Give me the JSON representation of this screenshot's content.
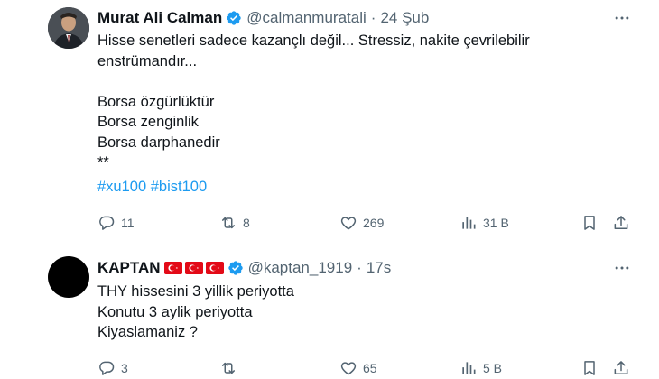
{
  "tweets": [
    {
      "name": "Murat Ali Calman",
      "handle": "@calmanmuratali",
      "separator": "·",
      "time": "24 Şub",
      "lines": [
        "Hisse senetleri sadece kazançlı değil... Stressiz, nakite çevrilebilir",
        "enstrümandır...",
        "",
        "Borsa özgürlüktür",
        "Borsa zenginlik",
        "Borsa darphanedir",
        "**"
      ],
      "hashtags": [
        "#xu100",
        "#bist100"
      ],
      "replies": "11",
      "retweets": "8",
      "likes": "269",
      "views": "31 B"
    },
    {
      "name": "KAPTAN",
      "flags": [
        "turkey-flag",
        "turkey-flag",
        "turkey-flag"
      ],
      "handle": "@kaptan_1919",
      "separator": "·",
      "time": "17s",
      "lines": [
        "THY hissesini 3 yillik periyotta",
        "Konutu 3 aylik periyotta",
        "Kiyaslamaniz  ?"
      ],
      "replies": "3",
      "retweets": "",
      "likes": "65",
      "views": "5 B"
    }
  ],
  "colors": {
    "text": "#0f1419",
    "secondary": "#536471",
    "link": "#1d9bf0",
    "verified": "#1d9bf0",
    "divider": "#eff3f4",
    "flag": "#e30a17"
  },
  "icons": {
    "reply": "reply-icon",
    "retweet": "retweet-icon",
    "like": "heart-icon",
    "views": "views-icon",
    "bookmark": "bookmark-icon",
    "share": "share-icon",
    "more": "more-icon",
    "verified": "verified-badge-icon"
  }
}
